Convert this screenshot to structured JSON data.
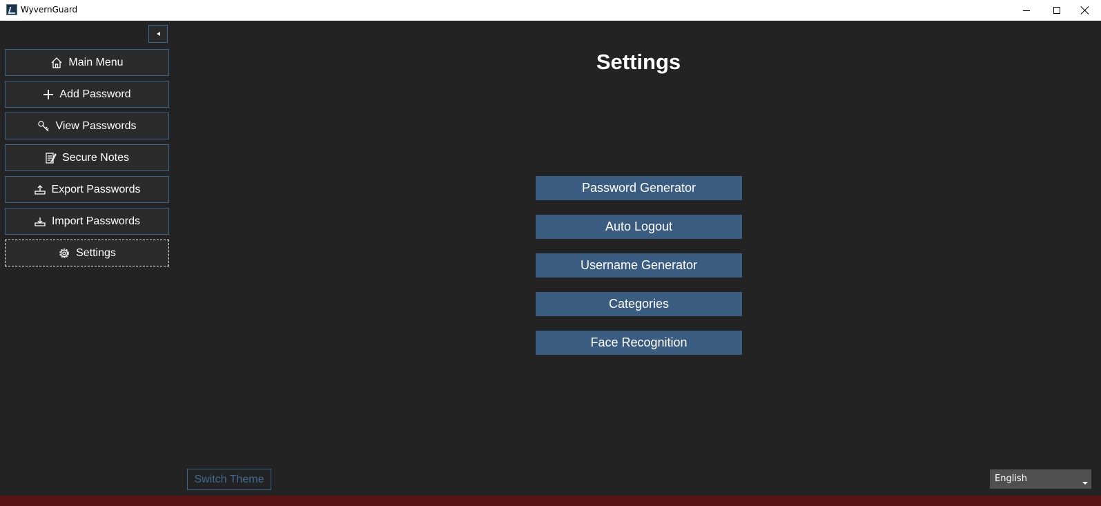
{
  "window": {
    "title": "WyvernGuard"
  },
  "sidebar": {
    "items": [
      {
        "label": "Main Menu",
        "icon": "home-icon"
      },
      {
        "label": "Add Password",
        "icon": "plus-icon"
      },
      {
        "label": "View Passwords",
        "icon": "key-icon"
      },
      {
        "label": "Secure Notes",
        "icon": "note-icon"
      },
      {
        "label": "Export Passwords",
        "icon": "export-icon"
      },
      {
        "label": "Import Passwords",
        "icon": "import-icon"
      },
      {
        "label": "Settings",
        "icon": "gear-icon"
      }
    ]
  },
  "main": {
    "title": "Settings",
    "buttons": [
      "Password Generator",
      "Auto Logout",
      "Username Generator",
      "Categories",
      "Face Recognition"
    ]
  },
  "footer": {
    "theme_label": "Switch Theme",
    "language": "English"
  },
  "colors": {
    "background": "#232323",
    "accent": "#3a5c80",
    "border": "#3a6490"
  }
}
